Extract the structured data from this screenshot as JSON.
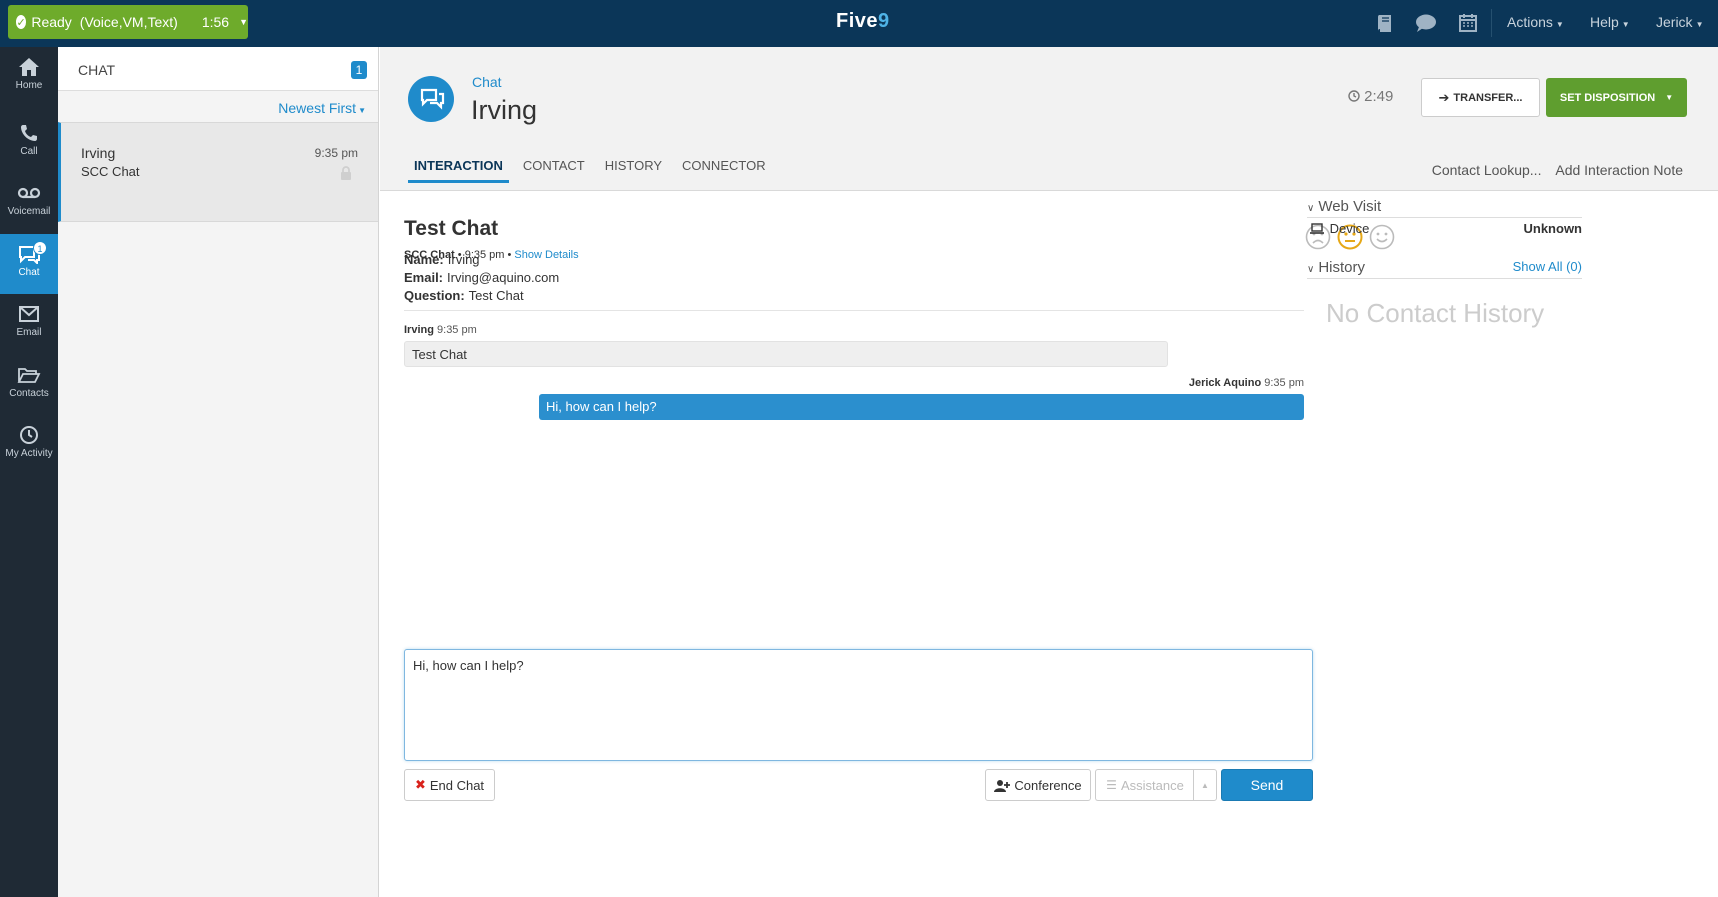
{
  "topbar": {
    "status": "Ready",
    "channels": "(Voice,VM,Text)",
    "timer": "1:56",
    "logo_text": "Five",
    "logo_accent": "9",
    "menus": [
      "Actions",
      "Help",
      "Jerick"
    ],
    "icons": [
      "book-icon",
      "chat-bubble-icon",
      "calendar-icon"
    ]
  },
  "nav": {
    "items": [
      {
        "label": "Home",
        "icon": "home-icon"
      },
      {
        "label": "Call",
        "icon": "phone-icon"
      },
      {
        "label": "Voicemail",
        "icon": "voicemail-icon"
      },
      {
        "label": "Chat",
        "icon": "chat-icon",
        "badge": "1"
      },
      {
        "label": "Email",
        "icon": "envelope-icon"
      },
      {
        "label": "Contacts",
        "icon": "folder-icon"
      },
      {
        "label": "My Activity",
        "icon": "clock-icon"
      }
    ]
  },
  "list": {
    "title": "CHAT",
    "count": "1",
    "sort_label": "Newest First",
    "item": {
      "name": "Irving",
      "sub": "SCC Chat",
      "time": "9:35 pm"
    }
  },
  "header": {
    "kind": "Chat",
    "name": "Irving",
    "elapsed": "2:49",
    "transfer_label": "TRANSFER...",
    "disposition_label": "SET DISPOSITION",
    "tabs": [
      "INTERACTION",
      "CONTACT",
      "HISTORY",
      "CONNECTOR"
    ],
    "links": [
      "Contact Lookup...",
      "Add Interaction Note"
    ]
  },
  "interaction": {
    "title": "Test Chat",
    "source": "SCC Chat",
    "time": "9:35 pm",
    "show_details": "Show Details",
    "fields": [
      {
        "label": "Name:",
        "value": "Irving"
      },
      {
        "label": "Email:",
        "value": "Irving@aquino.com"
      },
      {
        "label": "Question:",
        "value": "Test Chat"
      }
    ],
    "messages": [
      {
        "author": "Irving",
        "time": "9:35 pm",
        "text": "Test Chat"
      },
      {
        "author": "Jerick Aquino",
        "time": "9:35 pm",
        "text": "Hi, how can I help?"
      }
    ],
    "composer_value": "Hi, how can I help?",
    "buttons": {
      "end": "End Chat",
      "conference": "Conference",
      "assistance": "Assistance",
      "send": "Send"
    }
  },
  "side": {
    "web_visit": "Web Visit",
    "device_label": "Device",
    "device_value": "Unknown",
    "history": "History",
    "show_all": "Show All (0)",
    "no_history": "No Contact History"
  },
  "colors": {
    "brand": "#0b3658",
    "accent": "#1f8bcb",
    "ready": "#6eab2b",
    "disposition": "#5f9e2f"
  }
}
